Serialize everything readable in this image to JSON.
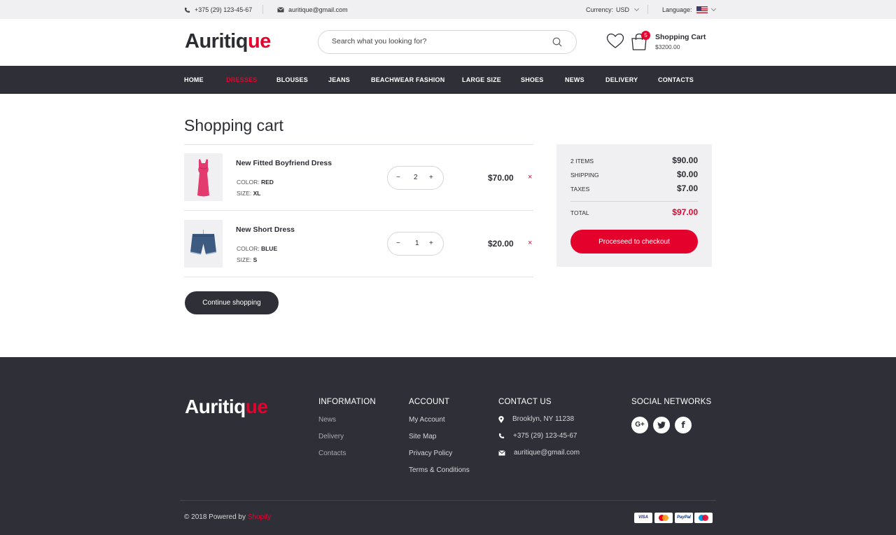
{
  "topbar": {
    "phone": "+375 (29) 123-45-67",
    "email": "auritique@gmail.com",
    "currency_label": "Currency:",
    "currency_value": "USD",
    "language_label": "Language:"
  },
  "header": {
    "logo_a": "Auritiq",
    "logo_b": "ue",
    "search_placeholder": "Search what you looking for?",
    "cart_count": "5",
    "cart_title": "Shopping Cart",
    "cart_total": "$3200.00"
  },
  "nav": {
    "items": [
      "HOME",
      "DRESSES",
      "BLOUSES",
      "JEANS",
      "BEACHWEAR FASHION",
      "LARGE SIZE",
      "SHOES",
      "NEWS",
      "DELIVERY",
      "CONTACTS"
    ],
    "active": "DRESSES"
  },
  "cart": {
    "title": "Shopping cart",
    "items": [
      {
        "name": "New Fitted Boyfriend Dress",
        "color_label": "COLOR:",
        "color": "RED",
        "size_label": "SIZE:",
        "size": "XL",
        "qty": "2",
        "price": "$70.00"
      },
      {
        "name": "New Short Dress",
        "color_label": "COLOR:",
        "color": "BLUE",
        "size_label": "SIZE:",
        "size": "S",
        "qty": "1",
        "price": "$20.00"
      }
    ],
    "continue_label": "Continue shopping"
  },
  "summary": {
    "items_label": "2 ITEMS",
    "items_value": "$90.00",
    "shipping_label": "SHIPPING",
    "shipping_value": "$0.00",
    "taxes_label": "TAXES",
    "taxes_value": "$7.00",
    "total_label": "TOTAL",
    "total_value": "$97.00",
    "checkout_label": "Proceseed to checkout"
  },
  "footer": {
    "logo_a": "Auritiq",
    "logo_b": "ue",
    "information": {
      "title": "INFORMATION",
      "links": [
        "News",
        "Delivery",
        "Contacts"
      ]
    },
    "account": {
      "title": "ACCOUNT",
      "links": [
        "My Account",
        "Site Map",
        "Privacy Policy",
        "Terms & Conditions"
      ]
    },
    "contact": {
      "title": "CONTACT US",
      "address": "Brooklyn, NY 11238",
      "phone": "+375 (29) 123-45-67",
      "email": "auritique@gmail.com"
    },
    "social": {
      "title": "SOCIAL NETWORKS",
      "icons": [
        "google-plus-icon",
        "twitter-icon",
        "facebook-icon"
      ]
    },
    "copyright_prefix": "© 2018 Powered by",
    "copyright_link": "Shopify",
    "payments": [
      "VISA",
      "mastercard",
      "PayPal",
      "maestro"
    ]
  },
  "colors": {
    "accent": "#e4022d",
    "dark": "#2f3037",
    "light_bg": "#f0f0f3"
  }
}
